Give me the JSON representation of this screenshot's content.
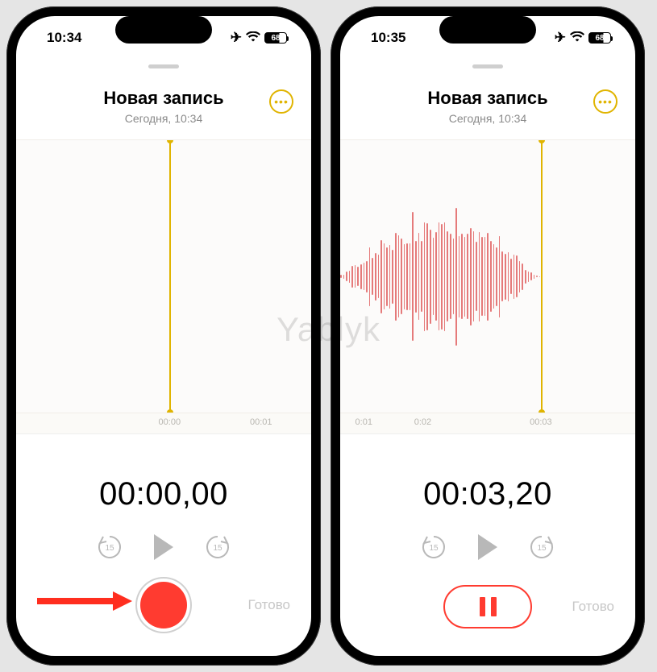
{
  "watermark": "Yablyk",
  "left": {
    "status_time": "10:34",
    "battery": "68",
    "title": "Новая запись",
    "subtitle": "Сегодня, 10:34",
    "playhead_pct": 52,
    "ticks": [
      {
        "pos": 52,
        "label": "00:00"
      },
      {
        "pos": 83,
        "label": "00:01"
      }
    ],
    "timer": "00:00,00",
    "skip_seconds": "15",
    "done": "Готово",
    "has_waveform": false,
    "mode": "record"
  },
  "right": {
    "status_time": "10:35",
    "battery": "68",
    "title": "Новая запись",
    "subtitle": "Сегодня, 10:34",
    "playhead_pct": 68,
    "ticks": [
      {
        "pos": 8,
        "label": "0:01"
      },
      {
        "pos": 28,
        "label": "0:02"
      },
      {
        "pos": 48,
        "label": ""
      },
      {
        "pos": 68,
        "label": "00:03"
      },
      {
        "pos": 97,
        "label": ""
      }
    ],
    "timer": "00:03,20",
    "skip_seconds": "15",
    "done": "Готово",
    "has_waveform": true,
    "mode": "pause"
  }
}
